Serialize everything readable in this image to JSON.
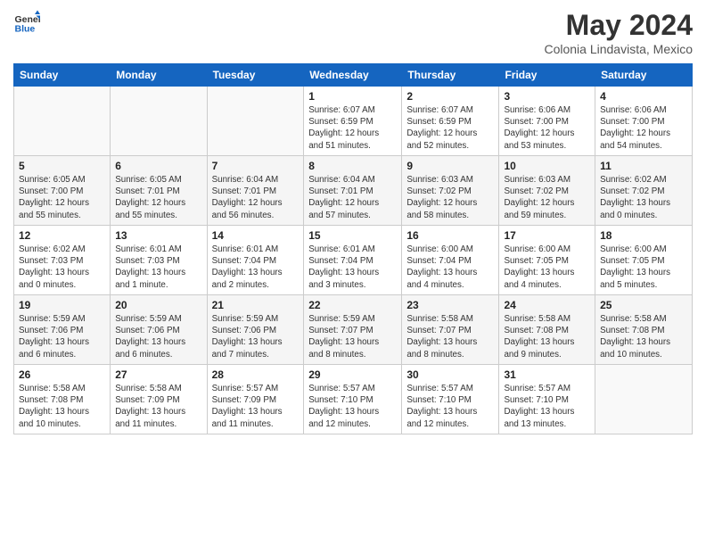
{
  "header": {
    "logo_line1": "General",
    "logo_line2": "Blue",
    "title": "May 2024",
    "subtitle": "Colonia Lindavista, Mexico"
  },
  "weekdays": [
    "Sunday",
    "Monday",
    "Tuesday",
    "Wednesday",
    "Thursday",
    "Friday",
    "Saturday"
  ],
  "weeks": [
    [
      {
        "day": "",
        "info": ""
      },
      {
        "day": "",
        "info": ""
      },
      {
        "day": "",
        "info": ""
      },
      {
        "day": "1",
        "info": "Sunrise: 6:07 AM\nSunset: 6:59 PM\nDaylight: 12 hours\nand 51 minutes."
      },
      {
        "day": "2",
        "info": "Sunrise: 6:07 AM\nSunset: 6:59 PM\nDaylight: 12 hours\nand 52 minutes."
      },
      {
        "day": "3",
        "info": "Sunrise: 6:06 AM\nSunset: 7:00 PM\nDaylight: 12 hours\nand 53 minutes."
      },
      {
        "day": "4",
        "info": "Sunrise: 6:06 AM\nSunset: 7:00 PM\nDaylight: 12 hours\nand 54 minutes."
      }
    ],
    [
      {
        "day": "5",
        "info": "Sunrise: 6:05 AM\nSunset: 7:00 PM\nDaylight: 12 hours\nand 55 minutes."
      },
      {
        "day": "6",
        "info": "Sunrise: 6:05 AM\nSunset: 7:01 PM\nDaylight: 12 hours\nand 55 minutes."
      },
      {
        "day": "7",
        "info": "Sunrise: 6:04 AM\nSunset: 7:01 PM\nDaylight: 12 hours\nand 56 minutes."
      },
      {
        "day": "8",
        "info": "Sunrise: 6:04 AM\nSunset: 7:01 PM\nDaylight: 12 hours\nand 57 minutes."
      },
      {
        "day": "9",
        "info": "Sunrise: 6:03 AM\nSunset: 7:02 PM\nDaylight: 12 hours\nand 58 minutes."
      },
      {
        "day": "10",
        "info": "Sunrise: 6:03 AM\nSunset: 7:02 PM\nDaylight: 12 hours\nand 59 minutes."
      },
      {
        "day": "11",
        "info": "Sunrise: 6:02 AM\nSunset: 7:02 PM\nDaylight: 13 hours\nand 0 minutes."
      }
    ],
    [
      {
        "day": "12",
        "info": "Sunrise: 6:02 AM\nSunset: 7:03 PM\nDaylight: 13 hours\nand 0 minutes."
      },
      {
        "day": "13",
        "info": "Sunrise: 6:01 AM\nSunset: 7:03 PM\nDaylight: 13 hours\nand 1 minute."
      },
      {
        "day": "14",
        "info": "Sunrise: 6:01 AM\nSunset: 7:04 PM\nDaylight: 13 hours\nand 2 minutes."
      },
      {
        "day": "15",
        "info": "Sunrise: 6:01 AM\nSunset: 7:04 PM\nDaylight: 13 hours\nand 3 minutes."
      },
      {
        "day": "16",
        "info": "Sunrise: 6:00 AM\nSunset: 7:04 PM\nDaylight: 13 hours\nand 4 minutes."
      },
      {
        "day": "17",
        "info": "Sunrise: 6:00 AM\nSunset: 7:05 PM\nDaylight: 13 hours\nand 4 minutes."
      },
      {
        "day": "18",
        "info": "Sunrise: 6:00 AM\nSunset: 7:05 PM\nDaylight: 13 hours\nand 5 minutes."
      }
    ],
    [
      {
        "day": "19",
        "info": "Sunrise: 5:59 AM\nSunset: 7:06 PM\nDaylight: 13 hours\nand 6 minutes."
      },
      {
        "day": "20",
        "info": "Sunrise: 5:59 AM\nSunset: 7:06 PM\nDaylight: 13 hours\nand 6 minutes."
      },
      {
        "day": "21",
        "info": "Sunrise: 5:59 AM\nSunset: 7:06 PM\nDaylight: 13 hours\nand 7 minutes."
      },
      {
        "day": "22",
        "info": "Sunrise: 5:59 AM\nSunset: 7:07 PM\nDaylight: 13 hours\nand 8 minutes."
      },
      {
        "day": "23",
        "info": "Sunrise: 5:58 AM\nSunset: 7:07 PM\nDaylight: 13 hours\nand 8 minutes."
      },
      {
        "day": "24",
        "info": "Sunrise: 5:58 AM\nSunset: 7:08 PM\nDaylight: 13 hours\nand 9 minutes."
      },
      {
        "day": "25",
        "info": "Sunrise: 5:58 AM\nSunset: 7:08 PM\nDaylight: 13 hours\nand 10 minutes."
      }
    ],
    [
      {
        "day": "26",
        "info": "Sunrise: 5:58 AM\nSunset: 7:08 PM\nDaylight: 13 hours\nand 10 minutes."
      },
      {
        "day": "27",
        "info": "Sunrise: 5:58 AM\nSunset: 7:09 PM\nDaylight: 13 hours\nand 11 minutes."
      },
      {
        "day": "28",
        "info": "Sunrise: 5:57 AM\nSunset: 7:09 PM\nDaylight: 13 hours\nand 11 minutes."
      },
      {
        "day": "29",
        "info": "Sunrise: 5:57 AM\nSunset: 7:10 PM\nDaylight: 13 hours\nand 12 minutes."
      },
      {
        "day": "30",
        "info": "Sunrise: 5:57 AM\nSunset: 7:10 PM\nDaylight: 13 hours\nand 12 minutes."
      },
      {
        "day": "31",
        "info": "Sunrise: 5:57 AM\nSunset: 7:10 PM\nDaylight: 13 hours\nand 13 minutes."
      },
      {
        "day": "",
        "info": ""
      }
    ]
  ]
}
